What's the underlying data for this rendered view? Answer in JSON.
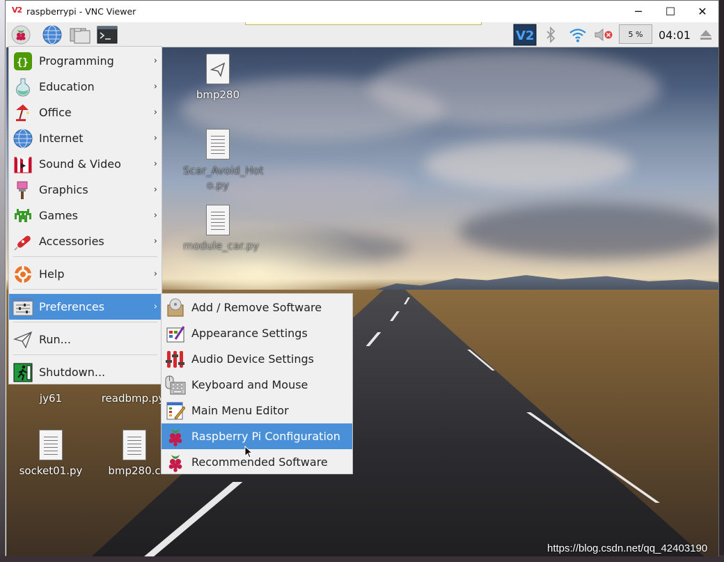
{
  "window": {
    "logo": "V2",
    "title": "raspberrypi - VNC Viewer",
    "minimize": "─",
    "maximize": "☐",
    "close": "✕"
  },
  "panel": {
    "cpu": "5 %",
    "clock": "04:01"
  },
  "desktop_icons": [
    {
      "label": "bmp280"
    },
    {
      "label": "Scar_Avoid_Hot\no.py"
    },
    {
      "label": "module_car.py"
    },
    {
      "label": "jy61"
    },
    {
      "label": "readbmp.py"
    },
    {
      "label": "socket01.py"
    },
    {
      "label": "bmp280.c"
    }
  ],
  "menu": {
    "items": [
      {
        "label": "Programming",
        "icon": "programming-icon"
      },
      {
        "label": "Education",
        "icon": "education-icon"
      },
      {
        "label": "Office",
        "icon": "office-icon"
      },
      {
        "label": "Internet",
        "icon": "internet-icon"
      },
      {
        "label": "Sound & Video",
        "icon": "sound-video-icon"
      },
      {
        "label": "Graphics",
        "icon": "graphics-icon"
      },
      {
        "label": "Games",
        "icon": "games-icon"
      },
      {
        "label": "Accessories",
        "icon": "accessories-icon"
      },
      {
        "label": "Help",
        "icon": "help-icon"
      },
      {
        "label": "Preferences",
        "icon": "preferences-icon"
      },
      {
        "label": "Run...",
        "icon": "run-icon"
      },
      {
        "label": "Shutdown...",
        "icon": "shutdown-icon"
      }
    ],
    "arrow": "›"
  },
  "submenu": {
    "items": [
      {
        "label": "Add / Remove Software",
        "icon": "add-remove-software-icon"
      },
      {
        "label": "Appearance Settings",
        "icon": "appearance-settings-icon"
      },
      {
        "label": "Audio Device Settings",
        "icon": "audio-device-settings-icon"
      },
      {
        "label": "Keyboard and Mouse",
        "icon": "keyboard-mouse-icon"
      },
      {
        "label": "Main Menu Editor",
        "icon": "main-menu-editor-icon"
      },
      {
        "label": "Raspberry Pi Configuration",
        "icon": "raspberry-icon"
      },
      {
        "label": "Recommended Software",
        "icon": "raspberry-icon"
      }
    ]
  },
  "watermark": "https://blog.csdn.net/qq_42403190"
}
